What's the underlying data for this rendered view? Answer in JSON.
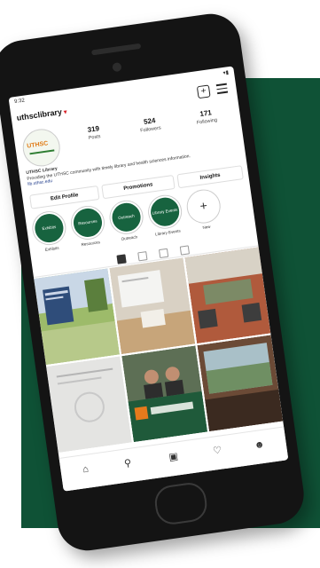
{
  "colors": {
    "brand_green": "#0f5236",
    "highlight_green": "#17633f",
    "accent_orange": "#e07b16"
  },
  "status_bar": {
    "time": "9:32",
    "signal": "▾▮"
  },
  "profile": {
    "username": "uthsclibrary",
    "avatar_text": "UTHSC",
    "stats": [
      {
        "value": "319",
        "label": "Posts"
      },
      {
        "value": "524",
        "label": "Followers"
      },
      {
        "value": "171",
        "label": "Following"
      }
    ],
    "bio_name": "UTHSC Library",
    "bio_text": "Providing the UTHSC community with timely library and health sciences information.",
    "bio_link": "lib.uthsc.edu"
  },
  "buttons": {
    "edit_profile": "Edit Profile",
    "promotions": "Promotions",
    "insights": "Insights"
  },
  "highlights": [
    {
      "circle": "Exhibits",
      "label": "Exhibits"
    },
    {
      "circle": "Resources",
      "label": "Resources"
    },
    {
      "circle": "Outreach",
      "label": "Outreach"
    },
    {
      "circle": "Library Events",
      "label": "Library Events"
    },
    {
      "circle": "+",
      "label": "New"
    }
  ],
  "icons": {
    "plus": "plus-square-icon",
    "menu": "hamburger-menu-icon",
    "grid_tab": "grid-icon",
    "reels_tab": "reels-icon",
    "igtv_tab": "video-icon",
    "tagged_tab": "tagged-icon",
    "home": "home-icon",
    "search": "search-icon",
    "shop": "shop-icon",
    "activity": "heart-icon",
    "profile": "profile-icon"
  }
}
